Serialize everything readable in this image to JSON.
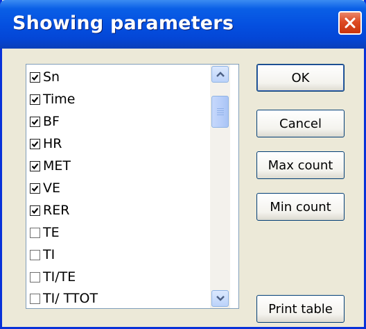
{
  "window": {
    "title": "Showing parameters",
    "close_icon": "close-icon"
  },
  "parameters": {
    "items": [
      {
        "label": "Sn",
        "checked": true
      },
      {
        "label": "Time",
        "checked": true
      },
      {
        "label": "BF",
        "checked": true
      },
      {
        "label": "HR",
        "checked": true
      },
      {
        "label": "MET",
        "checked": true
      },
      {
        "label": "VE",
        "checked": true
      },
      {
        "label": "RER",
        "checked": true
      },
      {
        "label": "TE",
        "checked": false
      },
      {
        "label": "TI",
        "checked": false
      },
      {
        "label": "TI/TE",
        "checked": false
      },
      {
        "label": "TI/ TTOT",
        "checked": false
      }
    ]
  },
  "buttons": {
    "ok": "OK",
    "cancel": "Cancel",
    "max_count": "Max count",
    "min_count": "Min count",
    "print_table": "Print table"
  },
  "colors": {
    "titlebar": "#0550e0",
    "close": "#dd4a23",
    "face": "#ece9d8"
  }
}
